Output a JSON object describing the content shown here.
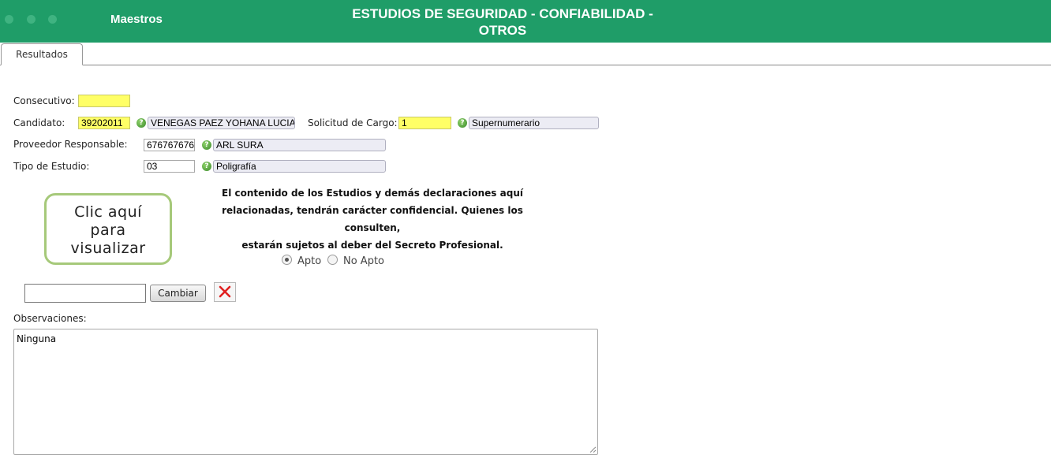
{
  "header": {
    "brand": "Maestros",
    "title_line1": "ESTUDIOS DE SEGURIDAD - CONFIABILIDAD -",
    "title_line2": "OTROS",
    "color": "#1f9d68"
  },
  "tabs": [
    {
      "label": "Resultados",
      "active": true
    }
  ],
  "form": {
    "consecutivo": {
      "label": "Consecutivo:",
      "value": ""
    },
    "candidato": {
      "label": "Candidato:",
      "code": "39202011",
      "name": "VENEGAS PAEZ YOHANA LUCIA"
    },
    "solicitud_cargo": {
      "label": "Solicitud de Cargo:",
      "code": "1",
      "name": "Supernumerario"
    },
    "proveedor": {
      "label": "Proveedor Responsable:",
      "code": "676767676",
      "name": "ARL SURA"
    },
    "tipo_estudio": {
      "label": "Tipo de Estudio:",
      "code": "03",
      "name": "Poligrafía"
    },
    "help_glyph": "?"
  },
  "visualize_button": {
    "line1": "Clic aquí",
    "line2": "para",
    "line3": "visualizar"
  },
  "notice": {
    "line1": "El contenido de los Estudios y demás declaraciones aquí",
    "line2": "relacionadas, tendrán carácter confidencial. Quienes los consulten,",
    "line3": "estarán sujetos al deber del Secreto Profesional."
  },
  "result": {
    "options": [
      {
        "label": "Apto",
        "selected": true
      },
      {
        "label": "No Apto",
        "selected": false
      }
    ]
  },
  "file": {
    "value": "",
    "change_label": "Cambiar"
  },
  "observaciones": {
    "label": "Observaciones:",
    "value": "Ninguna"
  },
  "icons": {
    "help": "help-icon",
    "delete": "close-icon",
    "window_dots": "window-dot-icon",
    "resize": "resize-grip-icon"
  },
  "colors": {
    "accent_green": "#1f9d68",
    "required_yellow": "#ffff66",
    "delete_red": "#e02020"
  }
}
